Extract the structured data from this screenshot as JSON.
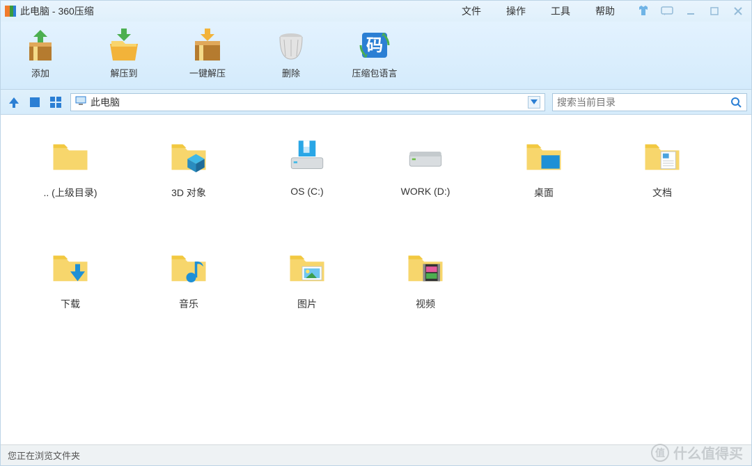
{
  "title": "此电脑 - 360压缩",
  "menubar": {
    "file": "文件",
    "operate": "操作",
    "tools": "工具",
    "help": "帮助"
  },
  "toolbar": {
    "add": "添加",
    "extract_to": "解压到",
    "one_click_extract": "一键解压",
    "delete": "删除",
    "archive_language": "压缩包语言"
  },
  "navbar": {
    "path": "此电脑",
    "search_placeholder": "搜索当前目录"
  },
  "items": {
    "parent": ".. (上级目录)",
    "objects3d": "3D 对象",
    "drive_c": "OS (C:)",
    "drive_d": "WORK (D:)",
    "desktop": "桌面",
    "documents": "文档",
    "downloads": "下载",
    "music": "音乐",
    "pictures": "图片",
    "videos": "视频"
  },
  "statusbar": {
    "text": "您正在浏览文件夹"
  },
  "watermark": {
    "badge": "值",
    "text": "什么值得买"
  }
}
